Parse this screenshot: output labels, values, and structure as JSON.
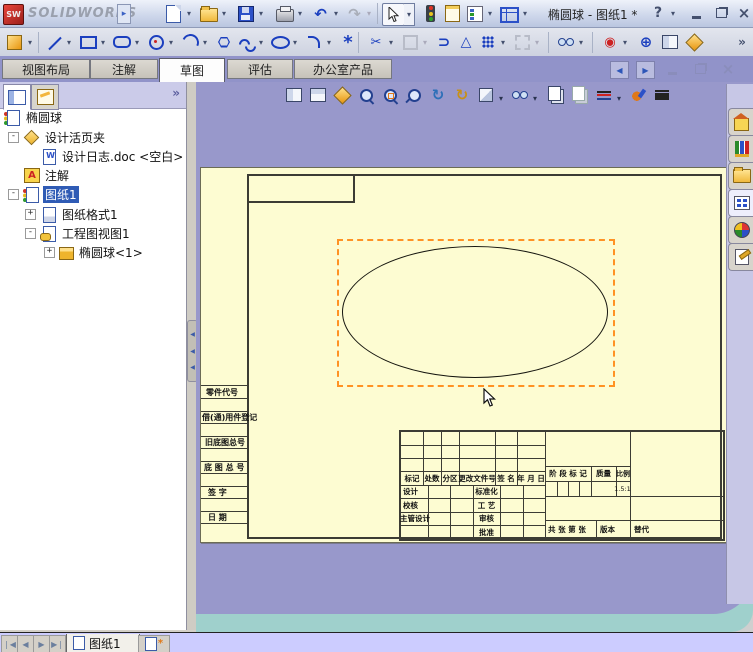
{
  "window": {
    "brand": "SOLIDWORKS",
    "title": "椭圆球 - 图纸1 *"
  },
  "icons": {
    "dropdown": "▾",
    "overflow": "»",
    "menu_arrow": "▸",
    "help": "?",
    "close": "×",
    "undo": "↶",
    "redo": "↷",
    "refresh": "↻",
    "rotate": "↻",
    "point": "*",
    "mirror": "△",
    "offset": "⊃",
    "target": "⊕",
    "snap": "◉",
    "scissors": "✂",
    "panel_left": "◀",
    "panel_right": "▶",
    "nav_first": "❘◀",
    "nav_prev": "◀",
    "nav_next": "▶",
    "nav_last": "▶❘",
    "word": "W",
    "annotation": "A",
    "star": "*"
  },
  "toolbar_main": [
    "new-document",
    "open",
    "save",
    "print",
    "undo",
    "redo",
    "select",
    "rebuild",
    "file-properties",
    "options",
    "table",
    "help",
    "minimize",
    "restore",
    "close"
  ],
  "toolbar_sketch": [
    "sketch",
    "line",
    "rectangle",
    "slot",
    "circle",
    "arc",
    "polygon",
    "spline",
    "ellipse",
    "fillet",
    "point",
    "trim-entities",
    "convert-entities",
    "offset-entities",
    "mirror-entities",
    "linear-pattern",
    "move-entities",
    "display-relations",
    "quick-snaps",
    "centerpoint",
    "dimension",
    "sketch-picture"
  ],
  "headsup_toolbar": [
    "tile-horizontal",
    "tile-vertical",
    "3d-drawing-view",
    "zoom-to-fit",
    "zoom-to-area",
    "zoom-in-out",
    "refresh-view",
    "rotate-view",
    "view-orientation",
    "display-style",
    "copy",
    "paste",
    "line-format",
    "edit-color",
    "line-thickness"
  ],
  "command_tabs": {
    "items": [
      {
        "label": "视图布局",
        "active": false
      },
      {
        "label": "注解",
        "active": false
      },
      {
        "label": "草图",
        "active": true
      },
      {
        "label": "评估",
        "active": false
      },
      {
        "label": "办公室产品",
        "active": false
      }
    ]
  },
  "feature_tree": {
    "items": [
      {
        "label": "椭圆球",
        "expander": "",
        "icon": "drawing",
        "selected": false
      },
      {
        "label": "设计活页夹",
        "expander": "-",
        "icon": "design-binder",
        "selected": false
      },
      {
        "label": "设计日志.doc <空白>",
        "expander": "",
        "icon": "word-doc",
        "selected": false
      },
      {
        "label": "注解",
        "expander": "",
        "icon": "annotations",
        "selected": false
      },
      {
        "label": "图纸1",
        "expander": "-",
        "icon": "sheet",
        "selected": true
      },
      {
        "label": "图纸格式1",
        "expander": "+",
        "icon": "sheet-format",
        "selected": false
      },
      {
        "label": "工程图视图1",
        "expander": "-",
        "icon": "drawing-view",
        "selected": false
      },
      {
        "label": "椭圆球<1>",
        "expander": "+",
        "icon": "part",
        "selected": false
      }
    ]
  },
  "task_pane": {
    "tabs": [
      "solidworks-resources",
      "design-library",
      "file-explorer",
      "view-palette",
      "appearances",
      "custom-properties"
    ]
  },
  "sheet": {
    "margin_labels": [
      "零件代号",
      "借(通)用件登记",
      "旧底图总号",
      "底 图 总 号",
      "签  字",
      "日  期"
    ],
    "title_block": {
      "rev_header": [
        "标记",
        "处数",
        "分区",
        "更改文件号",
        "签 名",
        "年 月 日"
      ],
      "sign_rows": [
        {
          "c1": "设计",
          "c2": "标准化"
        },
        {
          "c1": "校核",
          "c2": "工 艺"
        },
        {
          "c1": "主管设计",
          "c2": "审核"
        },
        {
          "c1": "",
          "c2": "批准"
        }
      ],
      "stage_header": [
        "阶 段 标 记",
        "质量",
        "比例"
      ],
      "scale": "1.5:1",
      "pages": "共  张 第  张",
      "version": "版本",
      "substitute": "替代"
    }
  },
  "bottom_bar": {
    "sheet_tab_label": "图纸1"
  },
  "colors": {
    "graphics_bg": "#9898cb",
    "sheet": "#fdfcd2",
    "selection": "#2f5bb5",
    "view_border": "#ff9224",
    "teal_band": "#9fd0cc",
    "tab_bar": "#9193c9",
    "status_bar": "#ccccff"
  }
}
